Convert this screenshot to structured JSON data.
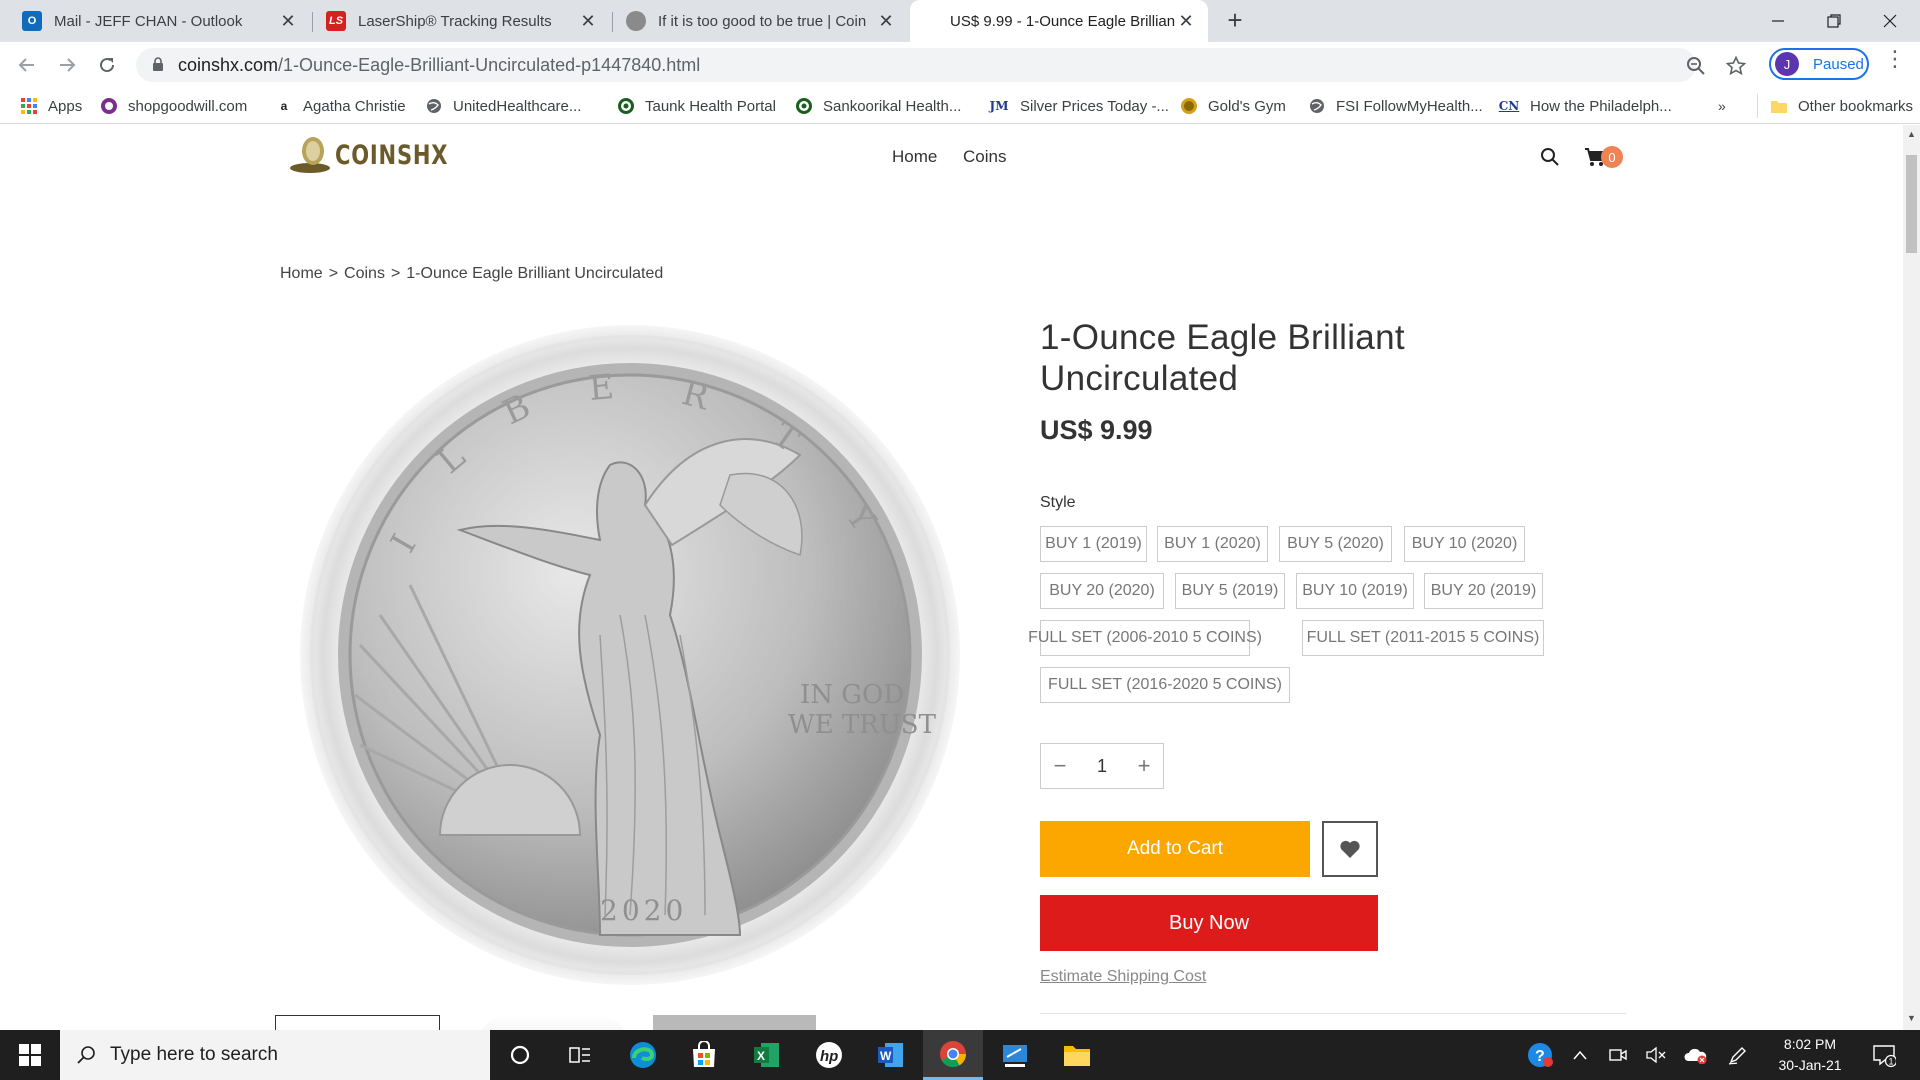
{
  "browser": {
    "tabs": [
      {
        "title": "Mail - JEFF CHAN - Outlook",
        "icon": "outlook-icon",
        "active": false
      },
      {
        "title": "LaserShip® Tracking Results",
        "icon": "lasership-icon",
        "active": false
      },
      {
        "title": "If it is too good to be true | Coin",
        "icon": "coin-icon",
        "active": false
      },
      {
        "title": "US$ 9.99 - 1-Ounce Eagle Brillian",
        "icon": "none",
        "active": true
      }
    ],
    "new_tab": "+",
    "url_host": "coinshx.com",
    "url_path": "/1-Ounce-Eagle-Brilliant-Uncirculated-p1447840.html",
    "profile_initial": "J",
    "profile_label": "Paused",
    "bookmarks": [
      {
        "label": "Apps",
        "icon": "apps-grid-icon"
      },
      {
        "label": "shopgoodwill.com",
        "icon": "goodwill-icon"
      },
      {
        "label": "Agatha Christie",
        "icon": "amazon-icon"
      },
      {
        "label": "UnitedHealthcare...",
        "icon": "globe-icon"
      },
      {
        "label": "Taunk Health Portal",
        "icon": "health-portal-icon"
      },
      {
        "label": "Sankoorikal Health...",
        "icon": "health-portal-icon"
      },
      {
        "label": "Silver Prices Today -...",
        "icon": "jm-icon"
      },
      {
        "label": "Gold's Gym",
        "icon": "golds-gym-icon"
      },
      {
        "label": "FSI FollowMyHealth...",
        "icon": "globe-icon"
      },
      {
        "label": "How the Philadelph...",
        "icon": "cn-icon"
      }
    ],
    "bookmarks_overflow": "»",
    "other_bookmarks": "Other bookmarks"
  },
  "site": {
    "logo_text": "COINSHX",
    "nav": [
      "Home",
      "Coins"
    ],
    "cart_count": "0"
  },
  "breadcrumb": {
    "items": [
      "Home",
      "Coins",
      "1-Ounce Eagle Brilliant Uncirculated"
    ],
    "separator": ">"
  },
  "coin": {
    "motto_line1": "IN GOD",
    "motto_line2": "WE TRUST",
    "year": "2020"
  },
  "product": {
    "title": "1-Ounce Eagle Brilliant Uncirculated",
    "price": "US$ 9.99",
    "style_label": "Style",
    "options": [
      "BUY 1 (2019)",
      "BUY 1 (2020)",
      "BUY 5 (2020)",
      "BUY 10 (2020)",
      "BUY 20 (2020)",
      "BUY 5 (2019)",
      "BUY 10 (2019)",
      "BUY 20 (2019)",
      "FULL SET (2006-2010 5 COINS)",
      "FULL SET (2011-2015 5 COINS)",
      "FULL SET (2016-2020 5 COINS)"
    ],
    "quantity": "1",
    "qty_minus": "−",
    "qty_plus": "+",
    "add_to_cart": "Add to Cart",
    "buy_now": "Buy Now",
    "shipping_link": "Estimate Shipping Cost"
  },
  "taskbar": {
    "search_placeholder": "Type here to search",
    "time": "8:02 PM",
    "date": "30-Jan-21",
    "notifications": "1"
  },
  "colors": {
    "add_to_cart": "#fca600",
    "buy_now": "#dd1b1b",
    "cart_badge": "#ef8354",
    "logo": "#6b5a2a"
  }
}
